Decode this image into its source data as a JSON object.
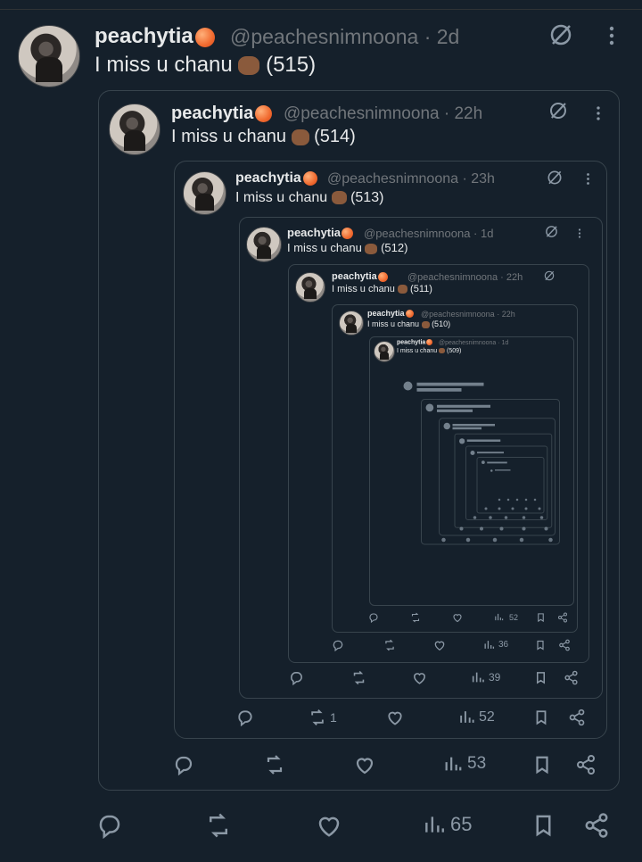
{
  "tweets": [
    {
      "name": "peachytia",
      "handle": "@peachesnimnoona · 2d",
      "text": "I miss u chanu",
      "count": "(515)"
    },
    {
      "name": "peachytia",
      "handle": "@peachesnimnoona · 22h",
      "text": "I miss u chanu",
      "count": "(514)"
    },
    {
      "name": "peachytia",
      "handle": "@peachesnimnoona · 23h",
      "text": "I miss u chanu",
      "count": "(513)"
    },
    {
      "name": "peachytia",
      "handle": "@peachesnimnoona · 1d",
      "text": "I miss u chanu",
      "count": "(512)"
    },
    {
      "name": "peachytia",
      "handle": "@peachesnimnoona · 22h",
      "text": "I miss u chanu",
      "count": "(511)"
    },
    {
      "name": "peachytia",
      "handle": "@peachesnimnoona · 22h",
      "text": "I miss u chanu",
      "count": "(510)"
    },
    {
      "name": "peachytia",
      "handle": "@peachesnimnoona · 1d",
      "text": "I miss u chanu",
      "count": "(509)"
    }
  ],
  "actions": {
    "level0": {
      "views": "65"
    },
    "level1": {
      "views": "53"
    },
    "level2": {
      "retweets": "1",
      "views": "52"
    },
    "level3": {
      "views": "39"
    },
    "level4": {
      "views": "36"
    },
    "level5": {
      "views": "52"
    }
  },
  "icons": {
    "reply": "reply-icon",
    "retweet": "retweet-icon",
    "like": "heart-icon",
    "views": "views-icon",
    "bookmark": "bookmark-icon",
    "share": "share-icon",
    "grok": "grok-icon",
    "more": "more-icon"
  },
  "colors": {
    "background": "#15202b",
    "text": "#e7e9ea",
    "muted": "#71767b",
    "border": "#38444d"
  }
}
